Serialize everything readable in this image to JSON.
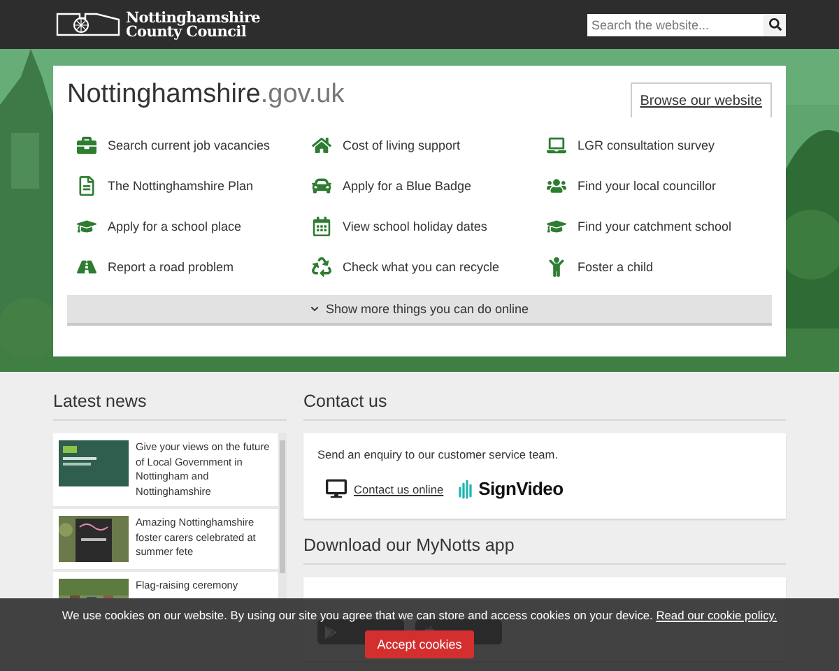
{
  "header": {
    "logo_text": [
      "Nottinghamshire",
      "County Council"
    ],
    "search": {
      "placeholder": "Search the website..."
    }
  },
  "hero": {
    "title": "Nottinghamshire",
    "title_suffix": ".gov.uk",
    "browse_button": "Browse our website",
    "links": [
      {
        "label": "Search current job vacancies"
      },
      {
        "label": "Cost of living support"
      },
      {
        "label": "LGR consultation survey"
      },
      {
        "label": "The Nottinghamshire Plan"
      },
      {
        "label": "Apply for a Blue Badge"
      },
      {
        "label": "Find your local councillor"
      },
      {
        "label": "Apply for a school place"
      },
      {
        "label": "View school holiday dates"
      },
      {
        "label": "Find your catchment school"
      },
      {
        "label": "Report a road problem"
      },
      {
        "label": "Check what you can recycle"
      },
      {
        "label": "Foster a child"
      }
    ],
    "show_more": {
      "label": "Show more things you can do online",
      "expanded": false
    }
  },
  "news": {
    "heading": "Latest news",
    "items": [
      {
        "title": "Give your views on the future of Local Government in Nottingham and Nottinghamshire",
        "kind": "picture"
      },
      {
        "title": "Amazing Nottinghamshire foster carers celebrated at summer fete",
        "kind": "picture"
      },
      {
        "title": "Flag-raising ceremony",
        "kind": "picture"
      }
    ]
  },
  "contact": {
    "heading": "Contact us",
    "text": "Send an enquiry to our customer service team.",
    "link": "Contact us online",
    "signvideo": "SignVideo"
  },
  "app": {
    "heading": "Download our MyNotts app"
  },
  "cookie": {
    "text": "We use cookies on our website. By using our site you agree that we can store and access cookies on your device.",
    "policy_link": "Read our cookie policy.",
    "accept": "Accept cookies"
  }
}
